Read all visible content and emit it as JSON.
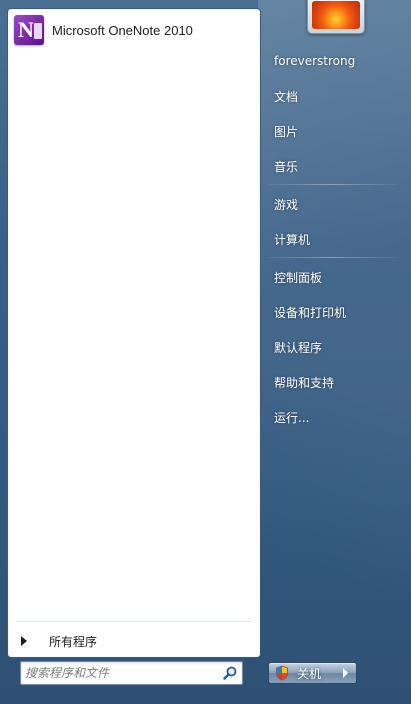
{
  "pinned_programs": [
    {
      "label": "Microsoft OneNote 2010",
      "icon": "onenote-icon"
    }
  ],
  "all_programs": {
    "label": "所有程序"
  },
  "search": {
    "placeholder": "搜索程序和文件",
    "icon": "search-icon"
  },
  "user_picture": {
    "icon": "flower-picture"
  },
  "right_items": [
    {
      "label": "foreverstrong"
    },
    {
      "label": "文档"
    },
    {
      "label": "图片"
    },
    {
      "label": "音乐"
    },
    {
      "label": "游戏"
    },
    {
      "label": "计算机"
    },
    {
      "label": "控制面板"
    },
    {
      "label": "设备和打印机"
    },
    {
      "label": "默认程序"
    },
    {
      "label": "帮助和支持"
    },
    {
      "label": "运行..."
    }
  ],
  "shutdown": {
    "label": "关机",
    "icon": "shield-icon",
    "options_icon": "chevron-right-icon"
  },
  "colors": {
    "right_panel": "#3a5f86",
    "left_panel": "#ffffff",
    "onenote_purple": "#7a2aa6"
  }
}
